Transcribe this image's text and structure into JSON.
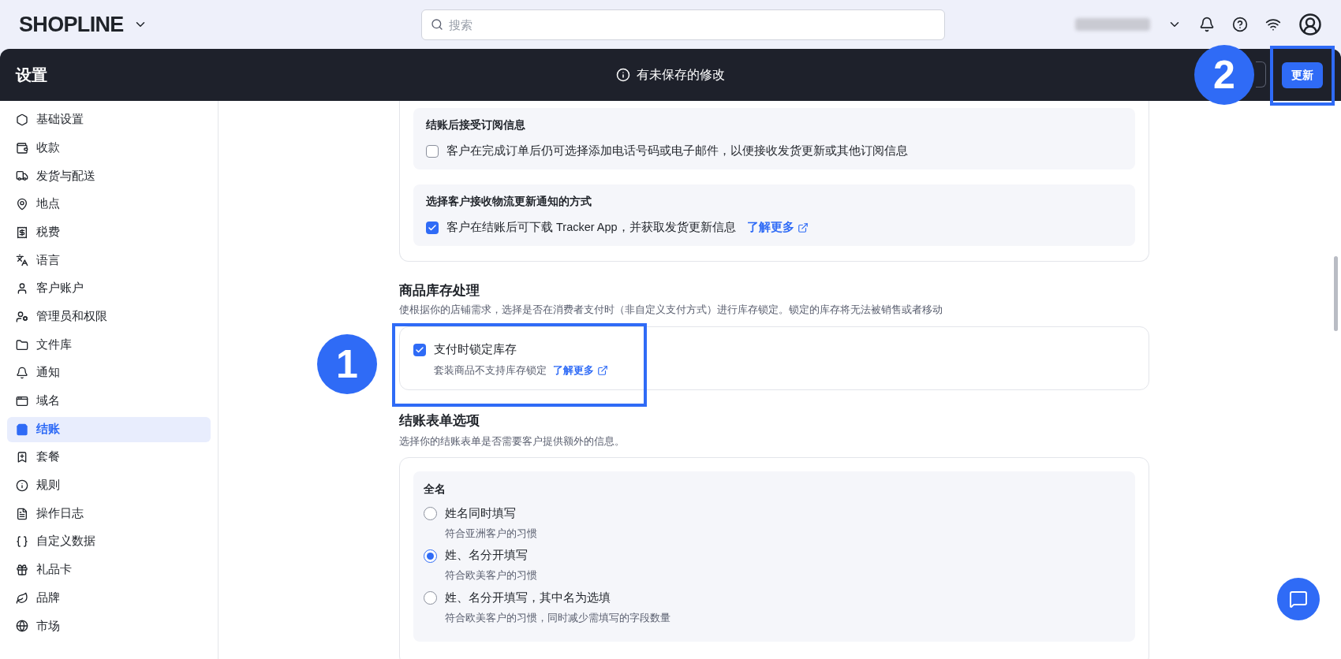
{
  "top_bar": {
    "logo": "SHOPLINE",
    "search": {
      "placeholder": "搜索"
    }
  },
  "header": {
    "title": "设置",
    "notice": "有未保存的修改",
    "primary_button": "更新"
  },
  "sidebar": {
    "items": [
      {
        "label": "基础设置",
        "selected": false
      },
      {
        "label": "收款",
        "selected": false
      },
      {
        "label": "发货与配送",
        "selected": false
      },
      {
        "label": "地点",
        "selected": false
      },
      {
        "label": "税费",
        "selected": false
      },
      {
        "label": "语言",
        "selected": false
      },
      {
        "label": "客户账户",
        "selected": false
      },
      {
        "label": "管理员和权限",
        "selected": false
      },
      {
        "label": "文件库",
        "selected": false
      },
      {
        "label": "通知",
        "selected": false
      },
      {
        "label": "域名",
        "selected": false
      },
      {
        "label": "结账",
        "selected": true
      },
      {
        "label": "套餐",
        "selected": false
      },
      {
        "label": "规则",
        "selected": false
      },
      {
        "label": "操作日志",
        "selected": false
      },
      {
        "label": "自定义数据",
        "selected": false
      },
      {
        "label": "礼品卡",
        "selected": false
      },
      {
        "label": "品牌",
        "selected": false
      },
      {
        "label": "市场",
        "selected": false
      }
    ]
  },
  "subscription_card": {
    "groups": [
      {
        "title": "结账后接受订阅信息",
        "option": {
          "label": "客户在完成订单后仍可选择添加电话号码或电子邮件，以便接收发货更新或其他订阅信息",
          "checked": false
        }
      },
      {
        "title": "选择客户接收物流更新通知的方式",
        "option": {
          "label": "客户在结账后可下载 Tracker App，并获取发货更新信息",
          "checked": true,
          "link": "了解更多"
        }
      }
    ]
  },
  "inventory_section": {
    "heading": "商品库存处理",
    "description": "使根据你的店铺需求，选择是否在消费者支付时（非自定义支付方式）进行库存锁定。锁定的库存将无法被销售或者移动",
    "option": {
      "label": "支付时锁定库存",
      "checked": true,
      "hint": "套装商品不支持库存锁定",
      "link": "了解更多"
    }
  },
  "checkout_form_section": {
    "heading": "结账表单选项",
    "description": "选择你的结账表单是否需要客户提供额外的信息。",
    "group": {
      "title": "全名",
      "options": [
        {
          "label": "姓名同时填写",
          "hint": "符合亚洲客户的习惯",
          "selected": false
        },
        {
          "label": "姓、名分开填写",
          "hint": "符合欧美客户的习惯",
          "selected": true
        },
        {
          "label": "姓、名分开填写，其中名为选填",
          "hint": "符合欧美客户的习惯，同时减少需填写的字段数量",
          "selected": false
        }
      ]
    }
  },
  "annotations": [
    {
      "number": "1"
    },
    {
      "number": "2"
    }
  ]
}
